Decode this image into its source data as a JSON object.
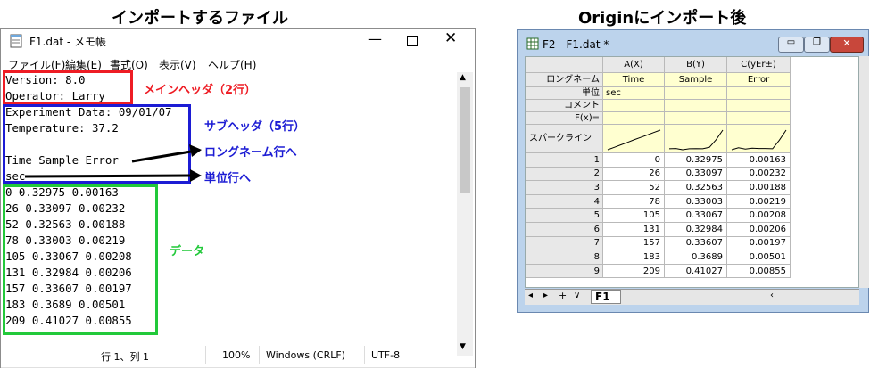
{
  "headings": {
    "left": "インポートするファイル",
    "right": "Originにインポート後"
  },
  "notepad": {
    "title": "F1.dat - メモ帳",
    "menu": [
      "ファイル(F)",
      "編集(E)",
      "書式(O)",
      "表示(V)",
      "ヘルプ(H)"
    ],
    "lines": [
      "Version: 8.0",
      "Operator: Larry",
      "Experiment Data: 09/01/07",
      "Temperature: 37.2",
      "",
      "Time Sample Error",
      "sec",
      "0 0.32975 0.00163",
      "26 0.33097 0.00232",
      "52 0.32563 0.00188",
      "78 0.33003 0.00219",
      "105 0.33067 0.00208",
      "131 0.32984 0.00206",
      "157 0.33607 0.00197",
      "183 0.3689 0.00501",
      "209 0.41027 0.00855"
    ],
    "status": {
      "position": "行 1、列 1",
      "zoom": "100%",
      "line_ending": "Windows (CRLF)",
      "encoding": "UTF-8"
    }
  },
  "annotations": {
    "main_header": "メインヘッダ（2行）",
    "sub_header": "サブヘッダ（5行）",
    "to_longname": "ロングネーム行へ",
    "to_units": "単位行へ",
    "data": "データ"
  },
  "origin": {
    "title": "F2 - F1.dat *",
    "columns": [
      "A(X)",
      "B(Y)",
      "C(yEr±)"
    ],
    "row_labels": {
      "longname": "ロングネーム",
      "units": "単位",
      "comments": "コメント",
      "fx": "F(x)=",
      "sparkline": "スパークライン"
    },
    "longnames": [
      "Time",
      "Sample",
      "Error"
    ],
    "units": [
      "sec",
      "",
      ""
    ],
    "rows": [
      [
        "1",
        "0",
        "0.32975",
        "0.00163"
      ],
      [
        "2",
        "26",
        "0.33097",
        "0.00232"
      ],
      [
        "3",
        "52",
        "0.32563",
        "0.00188"
      ],
      [
        "4",
        "78",
        "0.33003",
        "0.00219"
      ],
      [
        "5",
        "105",
        "0.33067",
        "0.00208"
      ],
      [
        "6",
        "131",
        "0.32984",
        "0.00206"
      ],
      [
        "7",
        "157",
        "0.33607",
        "0.00197"
      ],
      [
        "8",
        "183",
        "0.3689",
        "0.00501"
      ],
      [
        "9",
        "209",
        "0.41027",
        "0.00855"
      ]
    ],
    "sheet_tab": "F1"
  },
  "colors": {
    "red": "#ee1c24",
    "blue": "#1c1cd4",
    "green": "#22c93a"
  }
}
